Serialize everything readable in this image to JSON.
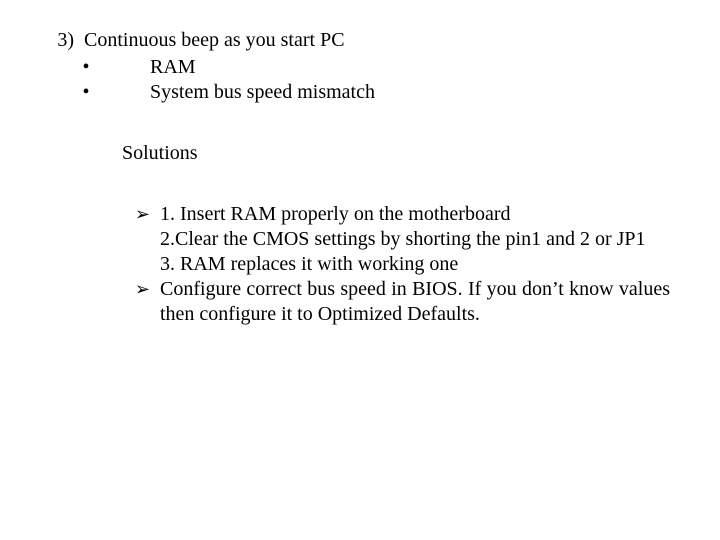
{
  "item": {
    "number": "3)",
    "title": "Continuous beep as you start PC",
    "causes_bullet": "•",
    "causes": [
      "RAM",
      "System bus speed mismatch"
    ],
    "solutions_label": "Solutions",
    "arrow": "➢",
    "solutions": [
      {
        "lines": [
          "1. Insert RAM properly on the motherboard",
          "2.Clear the CMOS settings by shorting the pin1 and 2 or JP1",
          "3. RAM replaces it with working one"
        ],
        "justify": false
      },
      {
        "lines": [
          " Configure correct bus speed in BIOS. If you don’t know values then configure it to Optimized Defaults."
        ],
        "justify": true
      }
    ]
  }
}
